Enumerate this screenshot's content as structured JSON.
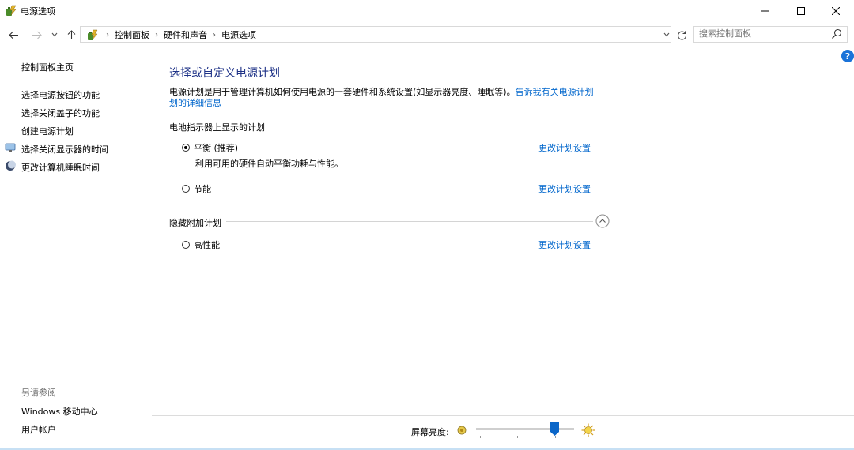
{
  "window": {
    "title": "电源选项",
    "minimize": "—",
    "maximize": "☐",
    "close": "✕"
  },
  "nav": {
    "back_icon": "arrow-left-icon",
    "forward_icon": "arrow-right-icon",
    "recent_icon": "chevron-down-icon",
    "up_icon": "arrow-up-icon"
  },
  "breadcrumb": {
    "items": [
      "控制面板",
      "硬件和声音",
      "电源选项"
    ],
    "separator": "›"
  },
  "search": {
    "placeholder": "搜索控制面板"
  },
  "sidebar": {
    "home": "控制面板主页",
    "items": [
      {
        "label": "选择电源按钮的功能",
        "icon": null
      },
      {
        "label": "选择关闭盖子的功能",
        "icon": null
      },
      {
        "label": "创建电源计划",
        "icon": null
      },
      {
        "label": "选择关闭显示器的时间",
        "icon": "monitor-icon"
      },
      {
        "label": "更改计算机睡眠时间",
        "icon": "moon-icon"
      }
    ],
    "see_also_title": "另请参阅",
    "see_also": [
      "Windows 移动中心",
      "用户帐户"
    ]
  },
  "main": {
    "title": "选择或自定义电源计划",
    "description": "电源计划是用于管理计算机如何使用电源的一套硬件和系统设置(如显示器亮度、睡眠等)。",
    "learn_more_line1": "告诉我有关电源计划",
    "learn_more_line2": "划的详细信息",
    "battery_section": "电池指示器上显示的计划",
    "plans": [
      {
        "name": "平衡 (推荐)",
        "selected": true,
        "description": "利用可用的硬件自动平衡功耗与性能。",
        "link": "更改计划设置"
      },
      {
        "name": "节能",
        "selected": false,
        "description": "",
        "link": "更改计划设置"
      }
    ],
    "hidden_section": "隐藏附加计划",
    "hidden_plans": [
      {
        "name": "高性能",
        "selected": false,
        "link": "更改计划设置"
      }
    ]
  },
  "brightness": {
    "label": "屏幕亮度:",
    "level_percent": 80
  },
  "colors": {
    "link": "#0066cc",
    "title": "#1e3287",
    "help": "#1a73d9"
  }
}
